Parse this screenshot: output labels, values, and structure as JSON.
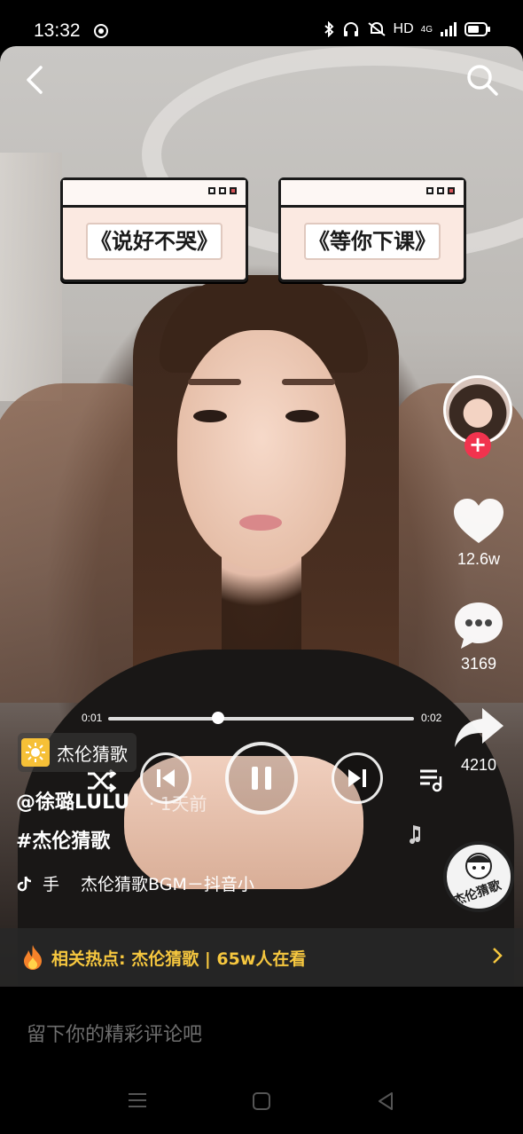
{
  "status_bar": {
    "time": "13:32",
    "network": "HD",
    "signal": "4G"
  },
  "video": {
    "song_cards": [
      {
        "title": "《说好不哭》"
      },
      {
        "title": "《等你下课》"
      }
    ],
    "progress": {
      "current": "0:01",
      "total": "0:02",
      "fraction": 0.36
    }
  },
  "side_actions": {
    "likes": "12.6w",
    "comments": "3169",
    "shares": "4210"
  },
  "info": {
    "topic_tag": "杰伦猜歌",
    "author": "@徐璐LULU",
    "time_ago": "1天前",
    "hashtag": "#杰伦猜歌",
    "music_prefix": "手",
    "music": "杰伦猜歌BGM－抖音小",
    "disc_text": "杰伦猜歌"
  },
  "hot_topic": {
    "text": "相关热点: 杰伦猜歌 | 65w人在看"
  },
  "comment": {
    "placeholder": "留下你的精彩评论吧"
  },
  "colors": {
    "accent_red": "#f1334e",
    "hot_yellow": "#f6c73f"
  }
}
